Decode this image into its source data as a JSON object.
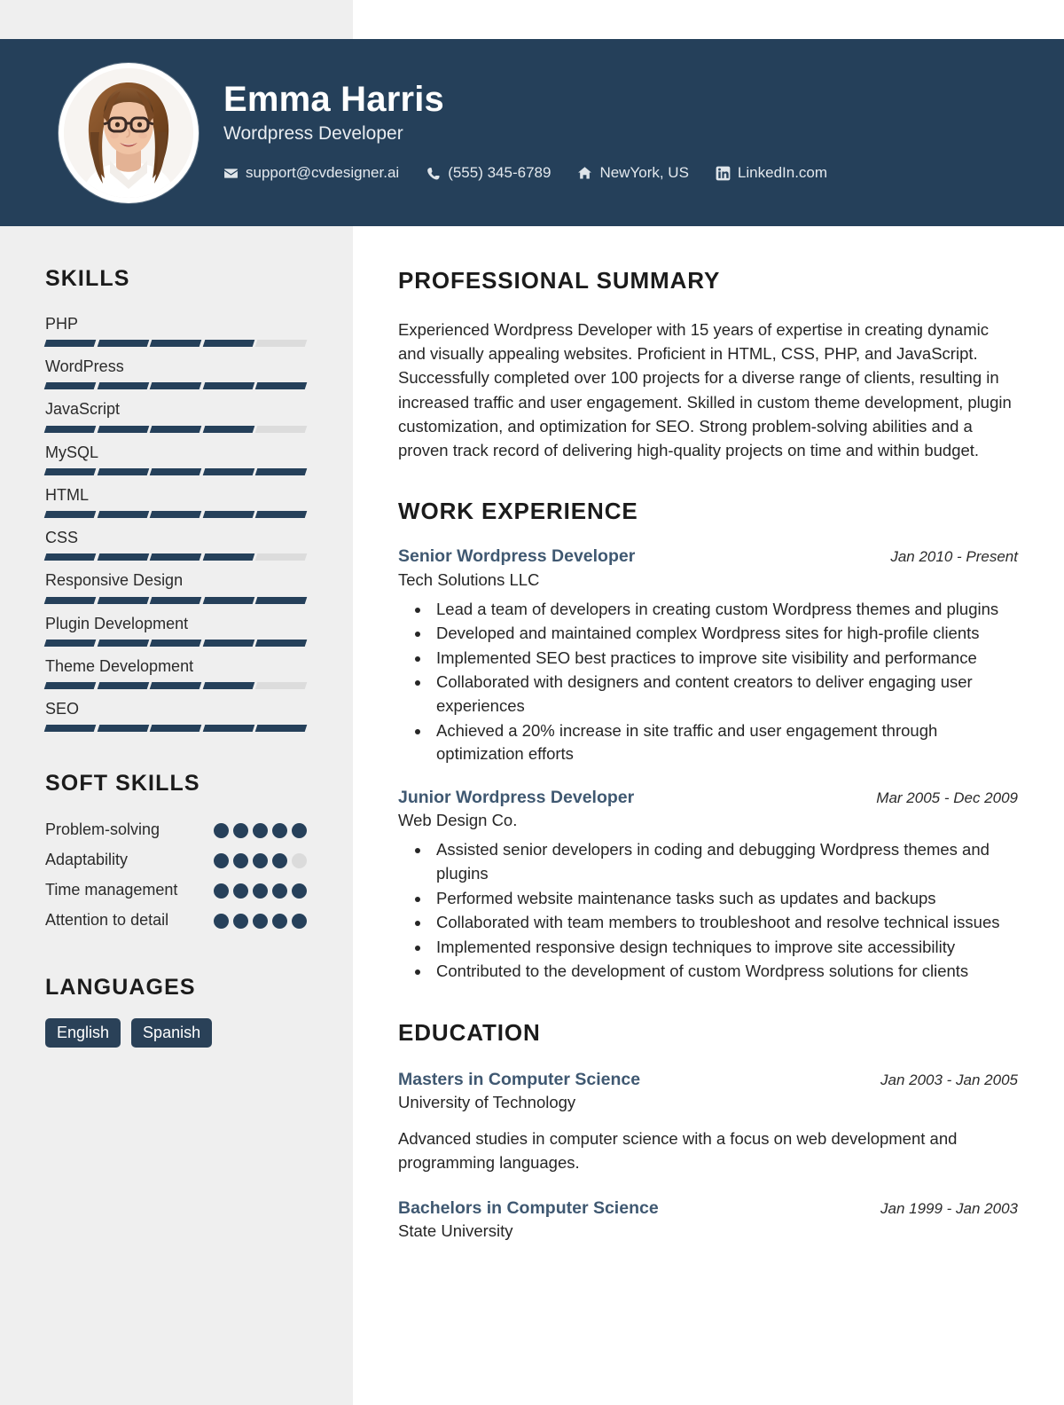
{
  "header": {
    "name": "Emma Harris",
    "job_title": "Wordpress Developer",
    "avatar_alt": "profile-photo",
    "contacts": [
      {
        "icon": "envelope-icon",
        "text": "support@cvdesigner.ai"
      },
      {
        "icon": "phone-icon",
        "text": "(555) 345-6789"
      },
      {
        "icon": "home-icon",
        "text": "NewYork, US"
      },
      {
        "icon": "linkedin-icon",
        "text": "LinkedIn.com"
      }
    ]
  },
  "sidebar": {
    "skills_heading": "SKILLS",
    "skills": [
      {
        "label": "PHP",
        "level": 4,
        "max": 5
      },
      {
        "label": "WordPress",
        "level": 5,
        "max": 5
      },
      {
        "label": "JavaScript",
        "level": 4,
        "max": 5
      },
      {
        "label": "MySQL",
        "level": 5,
        "max": 5
      },
      {
        "label": "HTML",
        "level": 5,
        "max": 5
      },
      {
        "label": "CSS",
        "level": 4,
        "max": 5
      },
      {
        "label": "Responsive Design",
        "level": 5,
        "max": 5
      },
      {
        "label": "Plugin Development",
        "level": 5,
        "max": 5
      },
      {
        "label": "Theme Development",
        "level": 4,
        "max": 5
      },
      {
        "label": "SEO",
        "level": 5,
        "max": 5
      }
    ],
    "soft_skills_heading": "SOFT SKILLS",
    "soft_skills": [
      {
        "label": "Problem-solving",
        "level": 5,
        "max": 5
      },
      {
        "label": "Adaptability",
        "level": 4,
        "max": 5
      },
      {
        "label": "Time management",
        "level": 5,
        "max": 5
      },
      {
        "label": "Attention to detail",
        "level": 5,
        "max": 5
      }
    ],
    "languages_heading": "LANGUAGES",
    "languages": [
      "English",
      "Spanish"
    ]
  },
  "main": {
    "summary_heading": "PROFESSIONAL SUMMARY",
    "summary_text": "Experienced Wordpress Developer with 15 years of expertise in creating dynamic and visually appealing websites. Proficient in HTML, CSS, PHP, and JavaScript. Successfully completed over 100 projects for a diverse range of clients, resulting in increased traffic and user engagement. Skilled in custom theme development, plugin customization, and optimization for SEO. Strong problem-solving abilities and a proven track record of delivering high-quality projects on time and within budget.",
    "experience_heading": "WORK EXPERIENCE",
    "experience": [
      {
        "title": "Senior Wordpress Developer",
        "date": "Jan 2010 - Present",
        "org": "Tech Solutions LLC",
        "bullets": [
          "Lead a team of developers in creating custom Wordpress themes and plugins",
          "Developed and maintained complex Wordpress sites for high-profile clients",
          "Implemented SEO best practices to improve site visibility and performance",
          "Collaborated with designers and content creators to deliver engaging user experiences",
          "Achieved a 20% increase in site traffic and user engagement through optimization efforts"
        ]
      },
      {
        "title": "Junior Wordpress Developer",
        "date": "Mar 2005 - Dec 2009",
        "org": "Web Design Co.",
        "bullets": [
          "Assisted senior developers in coding and debugging Wordpress themes and plugins",
          "Performed website maintenance tasks such as updates and backups",
          "Collaborated with team members to troubleshoot and resolve technical issues",
          "Implemented responsive design techniques to improve site accessibility",
          "Contributed to the development of custom Wordpress solutions for clients"
        ]
      }
    ],
    "education_heading": "EDUCATION",
    "education": [
      {
        "title": "Masters in Computer Science",
        "date": "Jan 2003 - Jan 2005",
        "org": "University of Technology",
        "description": "Advanced studies in computer science with a focus on web development and programming languages."
      },
      {
        "title": "Bachelors in Computer Science",
        "date": "Jan 1999 - Jan 2003",
        "org": "State University",
        "description": ""
      }
    ]
  },
  "colors": {
    "header_bg": "#25405a",
    "sidebar_bg": "#efefef",
    "accent": "#25405a",
    "entry_title": "#3f5871",
    "inactive_bar": "#dcdcdc",
    "inactive_dot": "#dbdbdb"
  }
}
